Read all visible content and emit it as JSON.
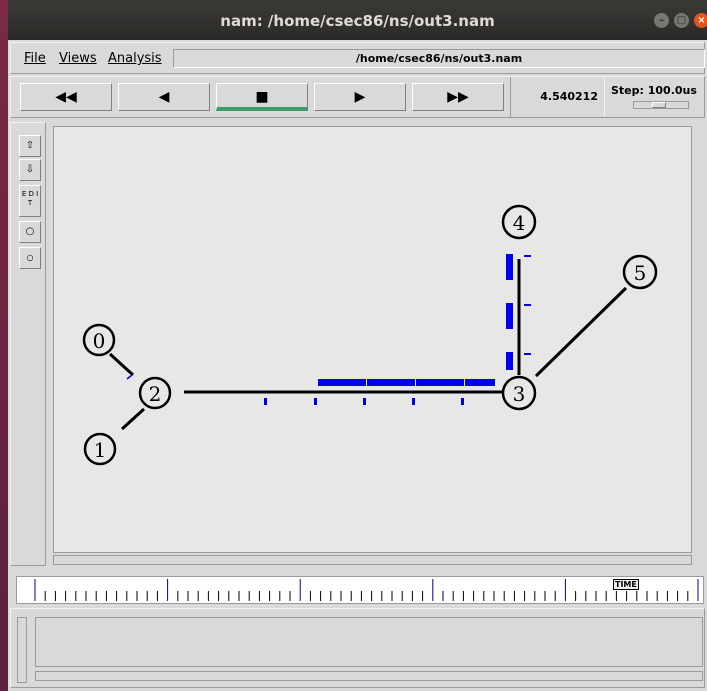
{
  "window": {
    "title": "nam: /home/csec86/ns/out3.nam"
  },
  "menu": {
    "file": "File",
    "views": "Views",
    "analysis": "Analysis"
  },
  "path": "/home/csec86/ns/out3.nam",
  "playback": {
    "rewind_fast": "◀◀",
    "rewind": "◀",
    "stop": "■",
    "play": "▶",
    "forward_fast": "▶▶"
  },
  "time": "4.540212",
  "step": "Step: 100.0us",
  "left_tools": {
    "edit_label": "E D I T"
  },
  "timeline": {
    "label": "TIME"
  },
  "topology": {
    "nodes": [
      {
        "id": "0",
        "label": "0"
      },
      {
        "id": "1",
        "label": "1"
      },
      {
        "id": "2",
        "label": "2"
      },
      {
        "id": "3",
        "label": "3"
      },
      {
        "id": "4",
        "label": "4"
      },
      {
        "id": "5",
        "label": "5"
      }
    ],
    "links": [
      [
        "0",
        "2"
      ],
      [
        "1",
        "2"
      ],
      [
        "2",
        "3"
      ],
      [
        "3",
        "4"
      ],
      [
        "3",
        "5"
      ]
    ]
  },
  "colors": {
    "packet": "#0000ee",
    "active_button": "#3e9a6b",
    "close_button": "#e5541f"
  }
}
